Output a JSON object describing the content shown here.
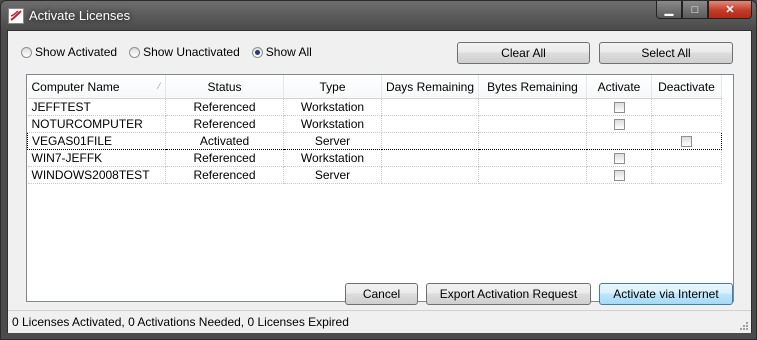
{
  "window": {
    "title": "Activate Licenses"
  },
  "filters": {
    "options": [
      {
        "label": "Show Activated",
        "checked": false
      },
      {
        "label": "Show Unactivated",
        "checked": false
      },
      {
        "label": "Show All",
        "checked": true
      }
    ]
  },
  "buttons": {
    "clear_all": "Clear All",
    "select_all": "Select All",
    "cancel": "Cancel",
    "export": "Export Activation Request",
    "activate_internet": "Activate via Internet"
  },
  "table": {
    "columns": [
      "Computer Name",
      "Status",
      "Type",
      "Days Remaining",
      "Bytes Remaining",
      "Activate",
      "Deactivate"
    ],
    "rows": [
      {
        "name": "JEFFTEST",
        "status": "Referenced",
        "type": "Workstation",
        "days": "",
        "bytes": "",
        "activate": true,
        "deactivate": false
      },
      {
        "name": "NOTURCOMPUTER",
        "status": "Referenced",
        "type": "Workstation",
        "days": "",
        "bytes": "",
        "activate": true,
        "deactivate": false
      },
      {
        "name": "VEGAS01FILE",
        "status": "Activated",
        "type": "Server",
        "days": "",
        "bytes": "",
        "activate": false,
        "deactivate": true
      },
      {
        "name": "WIN7-JEFFK",
        "status": "Referenced",
        "type": "Workstation",
        "days": "",
        "bytes": "",
        "activate": true,
        "deactivate": false
      },
      {
        "name": "WINDOWS2008TEST",
        "status": "Referenced",
        "type": "Server",
        "days": "",
        "bytes": "",
        "activate": true,
        "deactivate": false
      }
    ]
  },
  "statusbar": {
    "text": "0 Licenses Activated, 0 Activations Needed, 0 Licenses Expired"
  }
}
